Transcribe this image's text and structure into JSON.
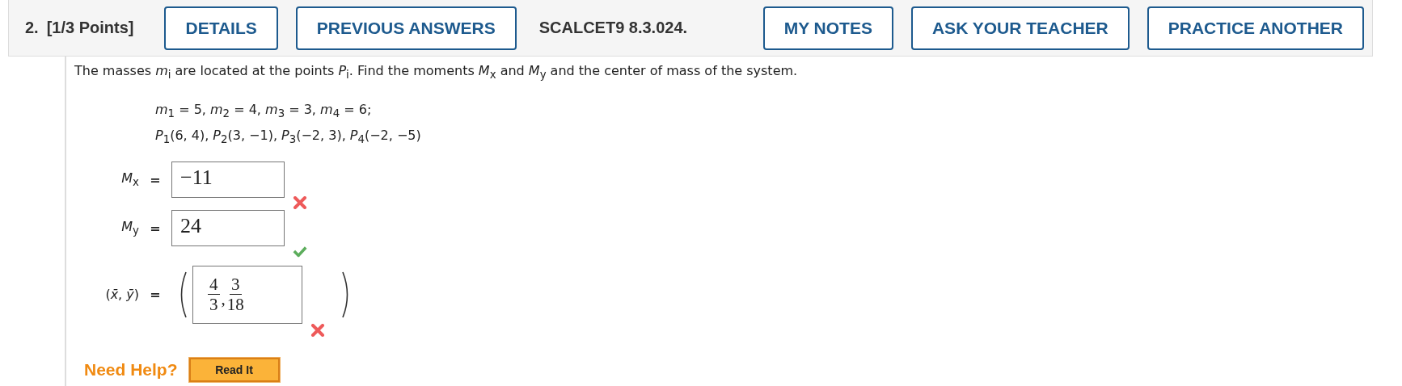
{
  "header": {
    "number": "2.",
    "points": "[1/3 Points]",
    "left_buttons": [
      "DETAILS",
      "PREVIOUS ANSWERS"
    ],
    "code": "SCALCET9 8.3.024.",
    "right_buttons": [
      "MY NOTES",
      "ASK YOUR TEACHER",
      "PRACTICE ANOTHER"
    ]
  },
  "statement": "The masses *m*$_{i}$ are located at the points *P*$_{i}$. Find the moments *M*$_{x}$ and *M*$_{y}$ and the center of mass of the system.",
  "given": [
    "*m*$_{1}$ = 5,  *m*$_{2}$ = 4,  *m*$_{3}$ = 3,  *m*$_{4}$ = 6;",
    "*P*$_{1}$(6, 4),  *P*$_{2}$(3, −1),  *P*$_{3}$(−2, 3),  *P*$_{4}$(−2, −5)"
  ],
  "answers": [
    {
      "kind": "single",
      "label": "*M*$_{x}$",
      "equals": "=",
      "value": "−11",
      "correct": false
    },
    {
      "kind": "single",
      "label": "*M*$_{y}$",
      "equals": "=",
      "value": "24",
      "correct": true
    },
    {
      "kind": "point",
      "label": "(*x̄*, *ȳ*)",
      "equals": "=",
      "fractions": [
        {
          "numerator": "4",
          "denominator": "3"
        },
        {
          "numerator": "3",
          "denominator": "18"
        }
      ],
      "separator": ",",
      "correct": false
    }
  ],
  "help": {
    "label": "Need Help?",
    "buttons": [
      "Read It"
    ]
  }
}
